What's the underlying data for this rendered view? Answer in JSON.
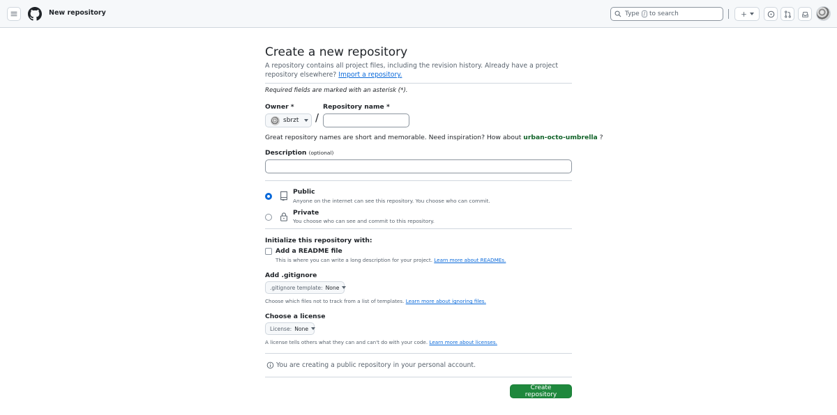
{
  "header": {
    "title": "New repository",
    "search_prefix": "Type",
    "search_key": "/",
    "search_suffix": "to search"
  },
  "page": {
    "title": "Create a new repository",
    "subtitle": "A repository contains all project files, including the revision history. Already have a project repository elsewhere?",
    "import_link": "Import a repository.",
    "required_note": "Required fields are marked with an asterisk (*)."
  },
  "owner": {
    "label": "Owner *",
    "value": "sbrzt"
  },
  "repo_name": {
    "label": "Repository name *",
    "value": ""
  },
  "name_hint": {
    "text": "Great repository names are short and memorable. Need inspiration? How about",
    "suggestion": "urban-octo-umbrella",
    "suffix": "?"
  },
  "description": {
    "label": "Description",
    "optional": "(optional)",
    "value": ""
  },
  "visibility": {
    "selected": "public",
    "public": {
      "title": "Public",
      "desc": "Anyone on the internet can see this repository. You choose who can commit."
    },
    "private": {
      "title": "Private",
      "desc": "You choose who can see and commit to this repository."
    }
  },
  "init": {
    "heading": "Initialize this repository with:",
    "readme_title": "Add a README file",
    "readme_desc": "This is where you can write a long description for your project.",
    "readme_link": "Learn more about READMEs.",
    "readme_checked": false
  },
  "gitignore": {
    "label": "Add .gitignore",
    "select_prefix": ".gitignore template:",
    "select_value": "None",
    "desc": "Choose which files not to track from a list of templates.",
    "link": "Learn more about ignoring files."
  },
  "license": {
    "label": "Choose a license",
    "select_prefix": "License:",
    "select_value": "None",
    "desc": "A license tells others what they can and can't do with your code.",
    "link": "Learn more about licenses."
  },
  "info_note": "You are creating a public repository in your personal account.",
  "submit_label": "Create repository",
  "colors": {
    "primary_button": "#1f883d",
    "link": "#0969da",
    "suggestion": "#116329"
  },
  "icons": [
    "hamburger-icon",
    "github-logo-icon",
    "search-icon",
    "plus-icon",
    "issues-icon",
    "pull-request-icon",
    "inbox-icon",
    "repo-icon",
    "lock-icon",
    "info-icon"
  ]
}
